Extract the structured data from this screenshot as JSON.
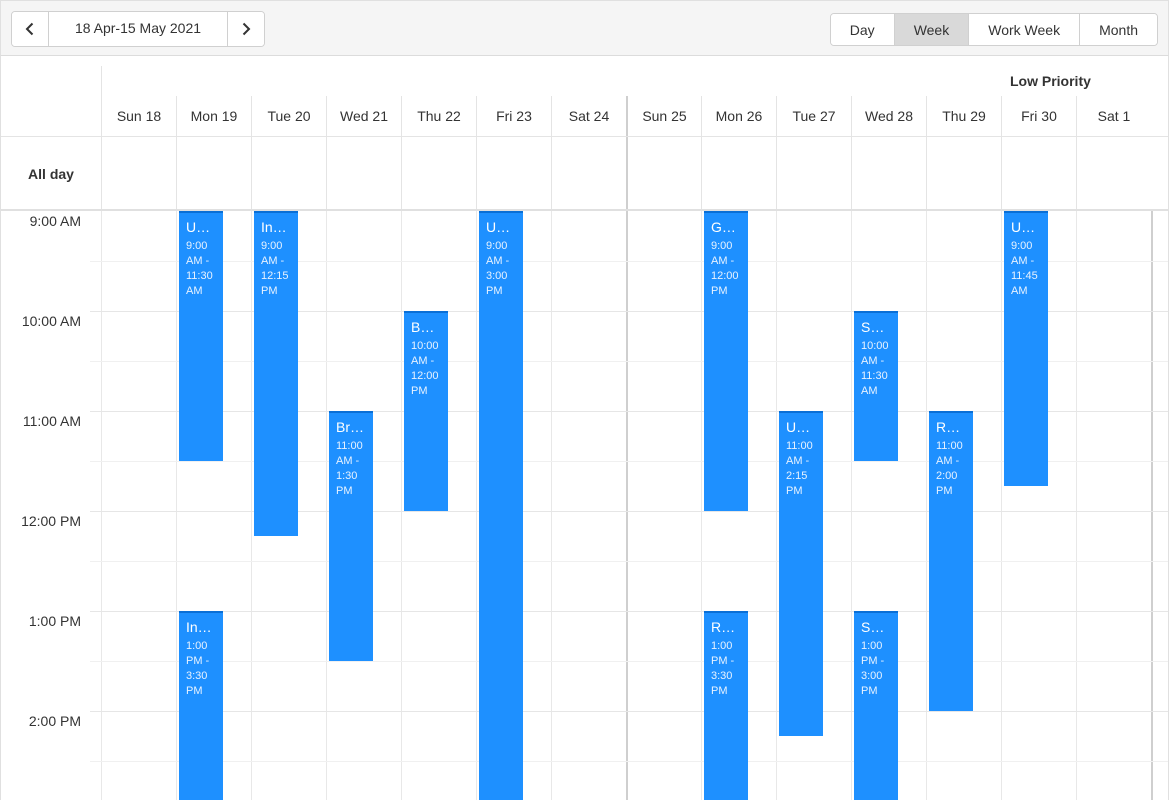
{
  "toolbar": {
    "date_range": "18 Apr-15 May 2021",
    "prev_icon": "chevron-left-icon",
    "next_icon": "chevron-right-icon",
    "views": [
      {
        "label": "Day",
        "active": false
      },
      {
        "label": "Week",
        "active": true
      },
      {
        "label": "Work Week",
        "active": false
      },
      {
        "label": "Month",
        "active": false
      }
    ]
  },
  "group": {
    "label": "Low Priority"
  },
  "days": [
    {
      "label": "Sun 18",
      "week_start": false
    },
    {
      "label": "Mon 19",
      "week_start": false
    },
    {
      "label": "Tue 20",
      "week_start": false
    },
    {
      "label": "Wed 21",
      "week_start": false
    },
    {
      "label": "Thu 22",
      "week_start": false
    },
    {
      "label": "Fri 23",
      "week_start": false
    },
    {
      "label": "Sat 24",
      "week_start": false
    },
    {
      "label": "Sun 25",
      "week_start": true
    },
    {
      "label": "Mon 26",
      "week_start": false
    },
    {
      "label": "Tue 27",
      "week_start": false
    },
    {
      "label": "Wed 28",
      "week_start": false
    },
    {
      "label": "Thu 29",
      "week_start": false
    },
    {
      "label": "Fri 30",
      "week_start": false
    },
    {
      "label": "Sat 1",
      "week_start": false
    }
  ],
  "allday_label": "All day",
  "time_slots": [
    "9:00 AM",
    "10:00 AM",
    "11:00 AM",
    "12:00 PM",
    "1:00 PM",
    "2:00 PM"
  ],
  "appointments": [
    {
      "day": 1,
      "title": "U…",
      "time": "9:00 AM - 11:30 AM",
      "start": 9.0,
      "end": 11.5
    },
    {
      "day": 1,
      "title": "In…",
      "time": "1:00 PM - 3:30 PM",
      "start": 13.0,
      "end": 15.5
    },
    {
      "day": 2,
      "title": "In…",
      "time": "9:00 AM - 12:15 PM",
      "start": 9.0,
      "end": 12.25
    },
    {
      "day": 3,
      "title": "Br…",
      "time": "11:00 AM - 1:30 PM",
      "start": 11.0,
      "end": 13.5
    },
    {
      "day": 4,
      "title": "B…",
      "time": "10:00 AM - 12:00 PM",
      "start": 10.0,
      "end": 12.0
    },
    {
      "day": 5,
      "title": "U…",
      "time": "9:00 AM - 3:00 PM",
      "start": 9.0,
      "end": 15.0
    },
    {
      "day": 8,
      "title": "G…",
      "time": "9:00 AM - 12:00 PM",
      "start": 9.0,
      "end": 12.0
    },
    {
      "day": 8,
      "title": "R…",
      "time": "1:00 PM - 3:30 PM",
      "start": 13.0,
      "end": 15.5
    },
    {
      "day": 9,
      "title": "U…",
      "time": "11:00 AM - 2:15 PM",
      "start": 11.0,
      "end": 14.25
    },
    {
      "day": 10,
      "title": "S…",
      "time": "10:00 AM - 11:30 AM",
      "start": 10.0,
      "end": 11.5
    },
    {
      "day": 10,
      "title": "S…",
      "time": "1:00 PM - 3:00 PM",
      "start": 13.0,
      "end": 15.0
    },
    {
      "day": 11,
      "title": "R…",
      "time": "11:00 AM - 2:00 PM",
      "start": 11.0,
      "end": 14.0
    },
    {
      "day": 12,
      "title": "U…",
      "time": "9:00 AM - 11:45 AM",
      "start": 9.0,
      "end": 11.75
    }
  ]
}
